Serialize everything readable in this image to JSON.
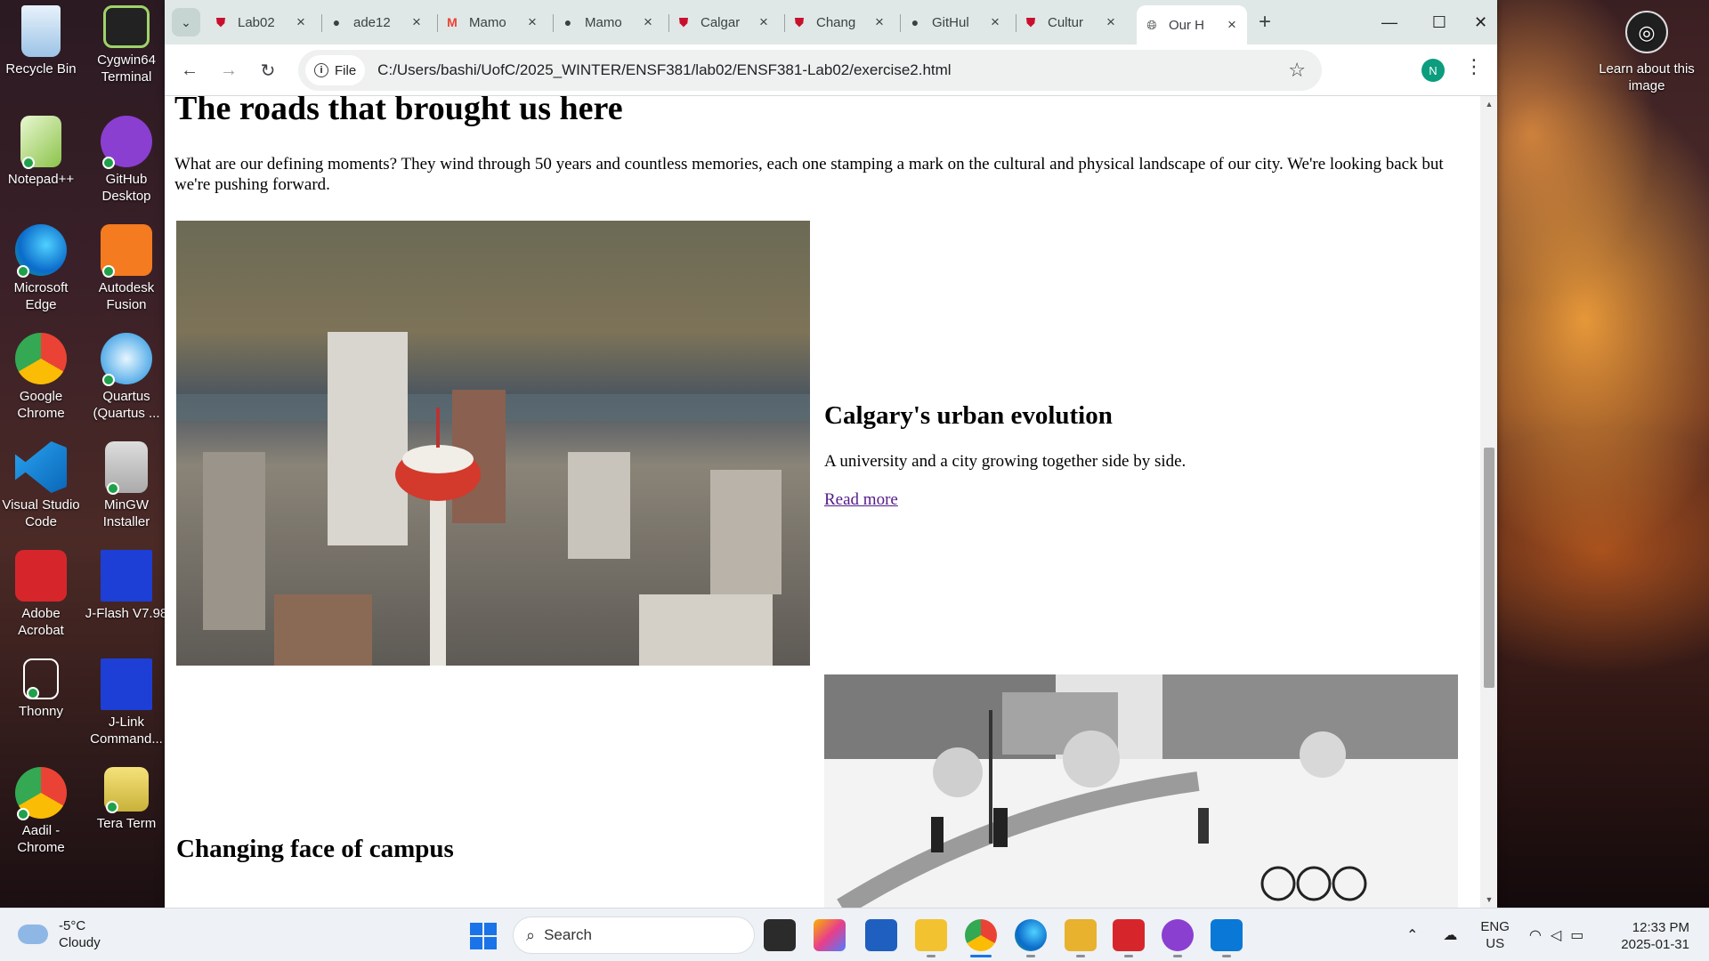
{
  "desktop": {
    "icons": [
      {
        "label": "Recycle Bin"
      },
      {
        "label": "Cygwin64 Terminal"
      },
      {
        "label": "Notepad++"
      },
      {
        "label": "GitHub Desktop"
      },
      {
        "label": "Microsoft Edge"
      },
      {
        "label": "Autodesk Fusion"
      },
      {
        "label": "Google Chrome"
      },
      {
        "label": "Quartus (Quartus ..."
      },
      {
        "label": "Visual Studio Code"
      },
      {
        "label": "MinGW Installer"
      },
      {
        "label": "Adobe Acrobat"
      },
      {
        "label": "J-Flash V7.98"
      },
      {
        "label": "Thonny"
      },
      {
        "label": "J-Link Command..."
      },
      {
        "label": "Aadil - Chrome"
      },
      {
        "label": "Tera Term"
      }
    ],
    "learn_about": "Learn about this image"
  },
  "browser": {
    "tabs": [
      {
        "title": "Lab02",
        "icon": "ucalgary-shield-icon"
      },
      {
        "title": "ade12",
        "icon": "github-icon"
      },
      {
        "title": "Mamo",
        "icon": "gmail-icon"
      },
      {
        "title": "Mamo",
        "icon": "github-icon"
      },
      {
        "title": "Calgar",
        "icon": "ucalgary-shield-icon"
      },
      {
        "title": "Chang",
        "icon": "ucalgary-shield-icon"
      },
      {
        "title": "GitHul",
        "icon": "github-icon"
      },
      {
        "title": "Cultur",
        "icon": "ucalgary-shield-icon"
      },
      {
        "title": "Our H",
        "icon": "globe-icon",
        "active": true
      }
    ],
    "file_chip": "File",
    "url": "C:/Users/bashi/UofC/2025_WINTER/ENSF381/lab02/ENSF381-Lab02/exercise2.html",
    "profile_initial": "N",
    "accent": "#0c9c7e"
  },
  "page": {
    "heading": "The roads that brought us here",
    "intro": "What are our defining moments? They wind through 50 years and countless memories, each one stamping a mark on the cultural and physical landscape of our city. We're looking back but we're pushing forward.",
    "card1": {
      "title": "Calgary's urban evolution",
      "text": "A university and a city growing together side by side.",
      "link": "Read more"
    },
    "card2": {
      "title": "Changing face of campus"
    }
  },
  "taskbar": {
    "weather_temp": "-5°C",
    "weather_desc": "Cloudy",
    "search_placeholder": "Search",
    "lang_top": "ENG",
    "lang_bottom": "US",
    "time": "12:33 PM",
    "date": "2025-01-31"
  }
}
